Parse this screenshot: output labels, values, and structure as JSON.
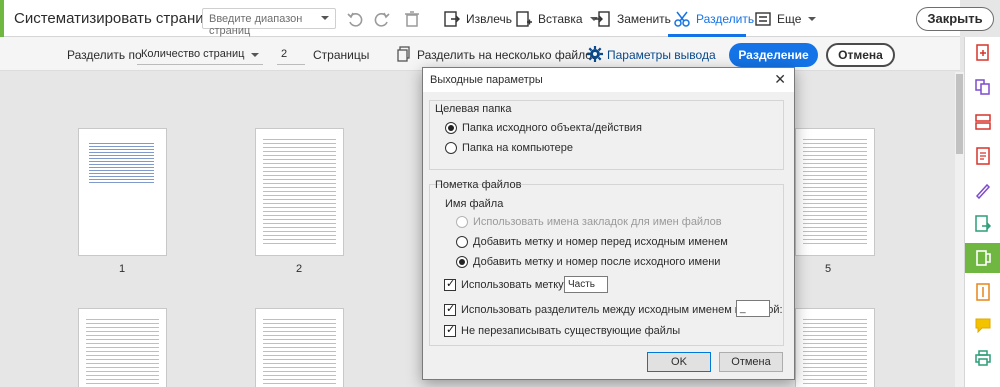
{
  "toolbar": {
    "title": "Систематизировать страницы",
    "range_placeholder": "Введите диапазон страниц",
    "extract": "Извлечь",
    "insert": "Вставка",
    "replace": "Заменить",
    "split": "Разделить",
    "more": "Еще",
    "close": "Закрыть",
    "colors": {
      "accent": "#6fb741",
      "active": "#1473e6"
    }
  },
  "split_bar": {
    "split_by_label": "Разделить по",
    "split_by_value": "Количество страниц",
    "count_value": "2",
    "pages_label": "Страницы",
    "split_multi_label": "Разделить на несколько файлов",
    "output_options_label": "Параметры вывода",
    "split_button": "Разделение",
    "cancel_button": "Отмена"
  },
  "pages": {
    "labels": [
      "1",
      "2",
      "5"
    ]
  },
  "dialog": {
    "title": "Выходные параметры",
    "target_folder": {
      "title": "Целевая папка",
      "option_source": "Папка исходного объекта/действия",
      "option_computer": "Папка на компьютере",
      "selected": "source"
    },
    "file_label": {
      "title": "Пометка файлов",
      "file_name_label": "Имя файла",
      "option_bookmarks": "Использовать имена закладок для имен файлов",
      "option_before": "Добавить метку и номер перед исходным именем",
      "option_after": "Добавить метку и номер после исходного имени",
      "selected": "after",
      "use_label": "Использовать метку:",
      "use_label_value": "Часть",
      "use_separator": "Использовать разделитель между исходным именем и меткой:",
      "separator_value": "_",
      "no_overwrite": "Не перезаписывать существующие файлы"
    },
    "ok": "OK",
    "cancel": "Отмена"
  }
}
